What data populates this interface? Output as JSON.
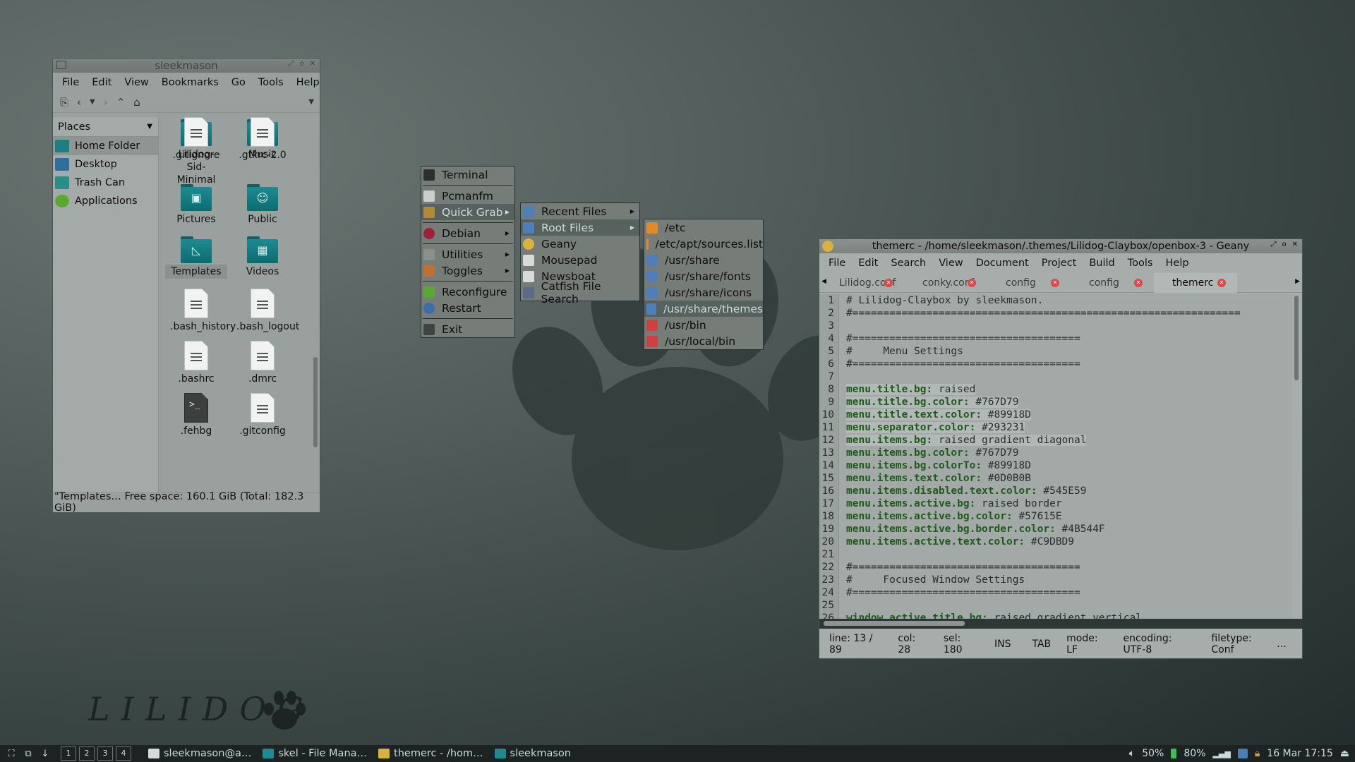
{
  "wallpaper": {
    "logo_text": "LILIDOG"
  },
  "file_manager": {
    "title": "sleekmason",
    "menu": [
      "File",
      "Edit",
      "View",
      "Bookmarks",
      "Go",
      "Tools",
      "Help"
    ],
    "places_label": "Places",
    "places": [
      {
        "label": "Home Folder",
        "icon": "home-icon"
      },
      {
        "label": "Desktop",
        "icon": "desktop-icon"
      },
      {
        "label": "Trash Can",
        "icon": "trash-icon"
      },
      {
        "label": "Applications",
        "icon": "applications-icon"
      }
    ],
    "items": [
      {
        "label": "Lilidog-Sid-\nMinimal",
        "kind": "folder"
      },
      {
        "label": "Music",
        "kind": "folder",
        "sym": "♫"
      },
      {
        "label": "Pictures",
        "kind": "folder",
        "sym": "▣"
      },
      {
        "label": "Public",
        "kind": "folder",
        "sym": "☺"
      },
      {
        "label": "Templates",
        "kind": "folder",
        "sym": "◺",
        "selected": true
      },
      {
        "label": "Videos",
        "kind": "folder",
        "sym": "▦"
      },
      {
        "label": ".bash_history",
        "kind": "doc"
      },
      {
        "label": ".bash_logout",
        "kind": "doc"
      },
      {
        "label": ".bashrc",
        "kind": "doc"
      },
      {
        "label": ".dmrc",
        "kind": "doc"
      },
      {
        "label": ".fehbg",
        "kind": "script"
      },
      {
        "label": ".gitconfig",
        "kind": "doc"
      },
      {
        "label": ".gitignore",
        "kind": "doc"
      },
      {
        "label": ".gtkrc-2.0",
        "kind": "doc"
      }
    ],
    "status": "\"Templates… Free space: 160.1 GiB (Total: 182.3 GiB)"
  },
  "root_menu": [
    {
      "label": "Terminal",
      "icon": "terminal-icon"
    },
    {
      "sep": true
    },
    {
      "label": "Pcmanfm",
      "icon": "pcmanfm-icon"
    },
    {
      "label": "Quick Grab",
      "icon": "quickgrab-icon",
      "submenu": true,
      "active": true
    },
    {
      "sep": true
    },
    {
      "label": "Debian",
      "icon": "debian-icon",
      "submenu": true
    },
    {
      "sep": true
    },
    {
      "label": "Utilities",
      "icon": "utilities-icon",
      "submenu": true
    },
    {
      "label": "Toggles",
      "icon": "toggles-icon",
      "submenu": true
    },
    {
      "sep": true
    },
    {
      "label": "Reconfigure",
      "icon": "reconfigure-icon"
    },
    {
      "label": "Restart",
      "icon": "restart-icon"
    },
    {
      "sep": true
    },
    {
      "label": "Exit",
      "icon": "exit-icon"
    }
  ],
  "quickgrab_menu": [
    {
      "label": "Recent Files",
      "icon": "folder-icon",
      "submenu": true
    },
    {
      "label": "Root Files",
      "icon": "folder-icon",
      "submenu": true,
      "active": true
    },
    {
      "label": "Geany",
      "icon": "geany-icon"
    },
    {
      "label": "Mousepad",
      "icon": "mousepad-icon"
    },
    {
      "label": "Newsboat",
      "icon": "newsboat-icon"
    },
    {
      "label": "Catfish File Search",
      "icon": "search-icon"
    }
  ],
  "rootfiles_menu": [
    {
      "label": "/etc",
      "icon": "folder-orange-icon"
    },
    {
      "label": "/etc/apt/sources.list",
      "icon": "folder-orange-icon"
    },
    {
      "label": "/usr/share",
      "icon": "folder-blue-icon"
    },
    {
      "label": "/usr/share/fonts",
      "icon": "folder-blue-icon"
    },
    {
      "label": "/usr/share/icons",
      "icon": "folder-blue-icon"
    },
    {
      "label": "/usr/share/themes",
      "icon": "folder-blue-icon",
      "active": true
    },
    {
      "label": "/usr/bin",
      "icon": "folder-red-icon"
    },
    {
      "label": "/usr/local/bin",
      "icon": "folder-red-icon"
    }
  ],
  "geany": {
    "title": "themerc - /home/sleekmason/.themes/Lilidog-Claybox/openbox-3 - Geany",
    "menu": [
      "File",
      "Edit",
      "Search",
      "View",
      "Document",
      "Project",
      "Build",
      "Tools",
      "Help"
    ],
    "tabs": [
      {
        "label": "Lilidog.conf"
      },
      {
        "label": "conky.conf"
      },
      {
        "label": "config"
      },
      {
        "label": "config"
      },
      {
        "label": "themerc",
        "active": true
      }
    ],
    "lines": [
      {
        "n": "1",
        "text": "# Lilidog-Claybox by sleekmason."
      },
      {
        "n": "2",
        "text": "#==============================================================="
      },
      {
        "n": "3",
        "text": ""
      },
      {
        "n": "4",
        "text": "#====================================="
      },
      {
        "n": "5",
        "text": "#     Menu Settings"
      },
      {
        "n": "6",
        "text": "#====================================="
      },
      {
        "n": "7",
        "text": ""
      },
      {
        "n": "8",
        "key": "menu.title.bg:",
        "val": " raised",
        "hl": true
      },
      {
        "n": "9",
        "key": "menu.title.bg.color:",
        "val": " #767D79",
        "hl": true
      },
      {
        "n": "10",
        "key": "menu.title.text.color:",
        "val": " #89918D",
        "hl": true
      },
      {
        "n": "11",
        "key": "menu.separator.color:",
        "val": " #293231",
        "hl": true
      },
      {
        "n": "12",
        "key": "menu.items.bg:",
        "val": " raised gradient diagonal",
        "hl": true
      },
      {
        "n": "13",
        "key": "menu.items.bg.color:",
        "val": " #767D79"
      },
      {
        "n": "14",
        "key": "menu.items.bg.colorTo:",
        "val": " #89918D"
      },
      {
        "n": "15",
        "key": "menu.items.text.color:",
        "val": " #0D0B0B"
      },
      {
        "n": "16",
        "key": "menu.items.disabled.text.color:",
        "val": " #545E59"
      },
      {
        "n": "17",
        "key": "menu.items.active.bg:",
        "val": " raised border"
      },
      {
        "n": "18",
        "key": "menu.items.active.bg.color:",
        "val": " #57615E"
      },
      {
        "n": "19",
        "key": "menu.items.active.bg.border.color:",
        "val": " #4B544F"
      },
      {
        "n": "20",
        "key": "menu.items.active.text.color:",
        "val": " #C9DBD9"
      },
      {
        "n": "21",
        "text": ""
      },
      {
        "n": "22",
        "text": "#====================================="
      },
      {
        "n": "23",
        "text": "#     Focused Window Settings"
      },
      {
        "n": "24",
        "text": "#====================================="
      },
      {
        "n": "25",
        "text": ""
      },
      {
        "n": "26",
        "key": "window.active.title.bg:",
        "val": " raised gradient vertical"
      }
    ],
    "status": {
      "line": "line: 13 / 89",
      "col": "col: 28",
      "sel": "sel: 180",
      "ins": "INS",
      "tab": "TAB",
      "mode": "mode: LF",
      "encoding": "encoding: UTF-8",
      "filetype": "filetype: Conf",
      "more": "…"
    }
  },
  "taskbar": {
    "desktops": [
      "1",
      "2",
      "3",
      "4"
    ],
    "tasks": [
      {
        "label": "sleekmason@a…",
        "icon": "terminal-icon"
      },
      {
        "label": "skel - File Mana…",
        "icon": "folder-icon"
      },
      {
        "label": "themerc - /hom…",
        "icon": "geany-icon"
      },
      {
        "label": "sleekmason",
        "icon": "folder-icon"
      }
    ],
    "volume": "50%",
    "battery": "80%",
    "clock": "16 Mar 17:15"
  },
  "colors": {
    "menu_bg": "#767D79",
    "menu_active_bg": "#57615E",
    "menu_active_text": "#C9DBD9",
    "menu_text": "#0D0B0B",
    "separator": "#293231",
    "folder_teal": "#1c8c92"
  }
}
